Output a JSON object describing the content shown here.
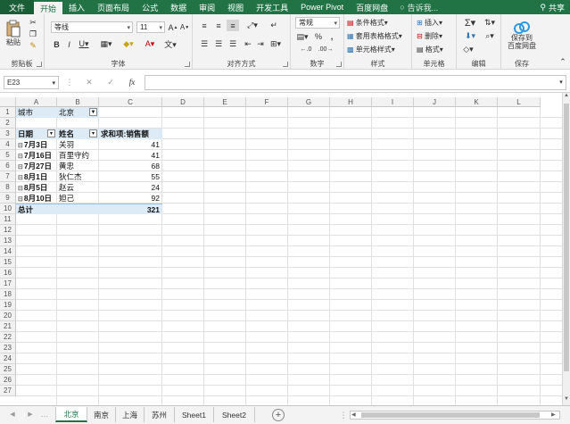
{
  "ribbon_tabs": [
    "文件",
    "开始",
    "插入",
    "页面布局",
    "公式",
    "数据",
    "审阅",
    "视图",
    "开发工具",
    "Power Pivot",
    "百度网盘"
  ],
  "tell_me": "告诉我...",
  "share": "共享",
  "clipboard": {
    "paste": "粘贴",
    "label": "剪贴板"
  },
  "font": {
    "name": "等线",
    "size": "11",
    "label": "字体"
  },
  "alignment": {
    "label": "对齐方式"
  },
  "number": {
    "format": "常规",
    "label": "数字",
    "percent": "%",
    "comma": ","
  },
  "styles": {
    "conditional": "条件格式",
    "table": "套用表格格式",
    "cell": "单元格样式",
    "label": "样式"
  },
  "cells": {
    "insert": "插入",
    "delete": "删除",
    "format": "格式",
    "label": "单元格"
  },
  "editing": {
    "label": "编辑"
  },
  "save": {
    "btn": "保存到百度网盘",
    "line1": "保存到",
    "line2": "百度网盘",
    "label": "保存"
  },
  "namebox": "E23",
  "fx": "fx",
  "columns": [
    "A",
    "B",
    "C",
    "D",
    "E",
    "F",
    "G",
    "H",
    "I",
    "J",
    "K",
    "L"
  ],
  "rows": [
    "1",
    "2",
    "3",
    "4",
    "5",
    "6",
    "7",
    "8",
    "9",
    "10",
    "11",
    "12",
    "13",
    "14",
    "15",
    "16",
    "17",
    "18",
    "19",
    "20",
    "21",
    "22",
    "23",
    "24",
    "25",
    "26",
    "27"
  ],
  "pivot": {
    "filter_label": "城市",
    "filter_value": "北京",
    "header_date": "日期",
    "header_name": "姓名",
    "header_value": "求和项:销售额",
    "rows": [
      {
        "date": "7月3日",
        "name": "关羽",
        "value": "41"
      },
      {
        "date": "7月16日",
        "name": "百里守约",
        "value": "41"
      },
      {
        "date": "7月27日",
        "name": "黄忠",
        "value": "68"
      },
      {
        "date": "8月1日",
        "name": "狄仁杰",
        "value": "55"
      },
      {
        "date": "8月5日",
        "name": "赵云",
        "value": "24"
      },
      {
        "date": "8月10日",
        "name": "妲己",
        "value": "92"
      }
    ],
    "total_label": "总计",
    "total_value": "321"
  },
  "sheets": [
    "北京",
    "南京",
    "上海",
    "苏州",
    "Sheet1",
    "Sheet2"
  ],
  "colors": {
    "excel_green": "#217346",
    "pivot_header": "#ddebf7"
  }
}
